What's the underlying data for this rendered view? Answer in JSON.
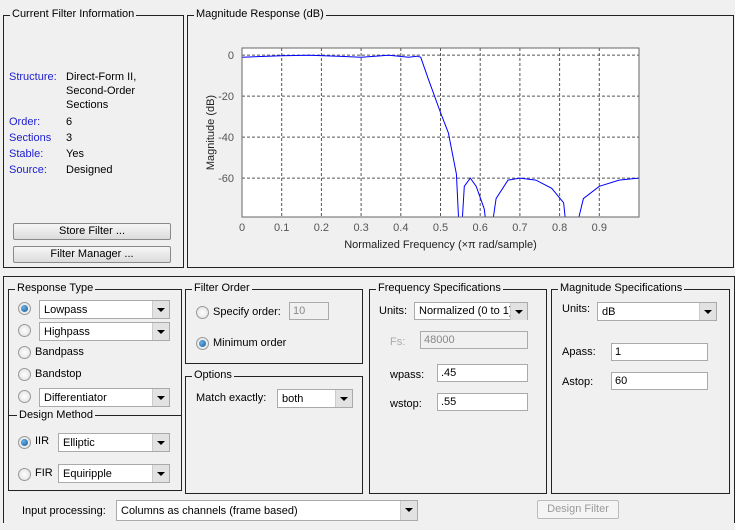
{
  "info": {
    "title": "Current Filter Information",
    "rows": [
      {
        "label": "Structure:",
        "value": "Direct-Form II, Second-Order Sections",
        "lines": [
          "Direct-Form II,",
          "Second-Order",
          "Sections"
        ]
      },
      {
        "label": "Order:",
        "value": "6"
      },
      {
        "label": "Sections",
        "value": "3"
      },
      {
        "label": "Stable:",
        "value": "Yes"
      },
      {
        "label": "Source:",
        "value": "Designed"
      }
    ],
    "store_button": "Store Filter ...",
    "manager_button": "Filter Manager ..."
  },
  "plot_panel": {
    "title": "Magnitude Response (dB)"
  },
  "chart_data": {
    "type": "line",
    "xlabel": "Normalized Frequency (×π rad/sample)",
    "ylabel": "Magnitude (dB)",
    "xlim": [
      0,
      1
    ],
    "ylim": [
      -79,
      3.5
    ],
    "xticks": [
      0,
      0.1,
      0.2,
      0.3,
      0.4,
      0.5,
      0.6,
      0.7,
      0.8,
      0.9
    ],
    "xtick_labels": [
      "0",
      "0.1",
      "0.2",
      "0.3",
      "0.4",
      "0.5",
      "0.6",
      "0.7",
      "0.8",
      "0.9"
    ],
    "yticks": [
      0,
      -20,
      -40,
      -60
    ],
    "ytick_labels": [
      "0",
      "-20",
      "-40",
      "-60"
    ],
    "grid": true,
    "color": "#0000ff",
    "series": [
      {
        "name": "Magnitude",
        "x": [
          0,
          0.1,
          0.17,
          0.25,
          0.3,
          0.37,
          0.42,
          0.44,
          0.45,
          0.47,
          0.5,
          0.52,
          0.54,
          0.548,
          0.552,
          0.56,
          0.575,
          0.59,
          0.61,
          0.62,
          0.625,
          0.64,
          0.67,
          0.7,
          0.74,
          0.78,
          0.81,
          0.82,
          0.835,
          0.86,
          0.9,
          0.95,
          1
        ],
        "y": [
          -1,
          -0.3,
          0,
          -0.6,
          -1,
          0,
          -1,
          -0.5,
          -1,
          -12,
          -28,
          -38,
          -58,
          -90,
          -90,
          -64,
          -60,
          -64,
          -75,
          -90,
          -90,
          -70,
          -61,
          -60,
          -61,
          -65,
          -72,
          -90,
          -90,
          -70,
          -64,
          -61,
          -60
        ]
      }
    ]
  },
  "response_type": {
    "title": "Response Type",
    "options": [
      {
        "label": "Lowpass",
        "dropdown": true,
        "selected": true
      },
      {
        "label": "Highpass",
        "dropdown": true,
        "selected": false
      },
      {
        "label": "Bandpass",
        "dropdown": false,
        "selected": false
      },
      {
        "label": "Bandstop",
        "dropdown": false,
        "selected": false
      },
      {
        "label": "Differentiator",
        "dropdown": true,
        "selected": false
      }
    ]
  },
  "design_method": {
    "title": "Design Method",
    "iir_label": "IIR",
    "iir_value": "Elliptic",
    "fir_label": "FIR",
    "fir_value": "Equiripple",
    "selected": "IIR"
  },
  "filter_order": {
    "title": "Filter Order",
    "specify_label": "Specify order:",
    "specify_value": "10",
    "minimum_label": "Minimum order",
    "selected": "minimum"
  },
  "options": {
    "title": "Options",
    "match_label": "Match exactly:",
    "match_value": "both"
  },
  "freq_spec": {
    "title": "Frequency Specifications",
    "units_label": "Units:",
    "units_value": "Normalized (0 to 1)",
    "fs_label": "Fs:",
    "fs_value": "48000",
    "wpass_label": "wpass:",
    "wpass_value": ".45",
    "wstop_label": "wstop:",
    "wstop_value": ".55"
  },
  "mag_spec": {
    "title": "Magnitude Specifications",
    "units_label": "Units:",
    "units_value": "dB",
    "apass_label": "Apass:",
    "apass_value": "1",
    "astop_label": "Astop:",
    "astop_value": "60"
  },
  "input_processing": {
    "label": "Input processing:",
    "value": "Columns as channels (frame based)"
  },
  "design_button": "Design Filter"
}
